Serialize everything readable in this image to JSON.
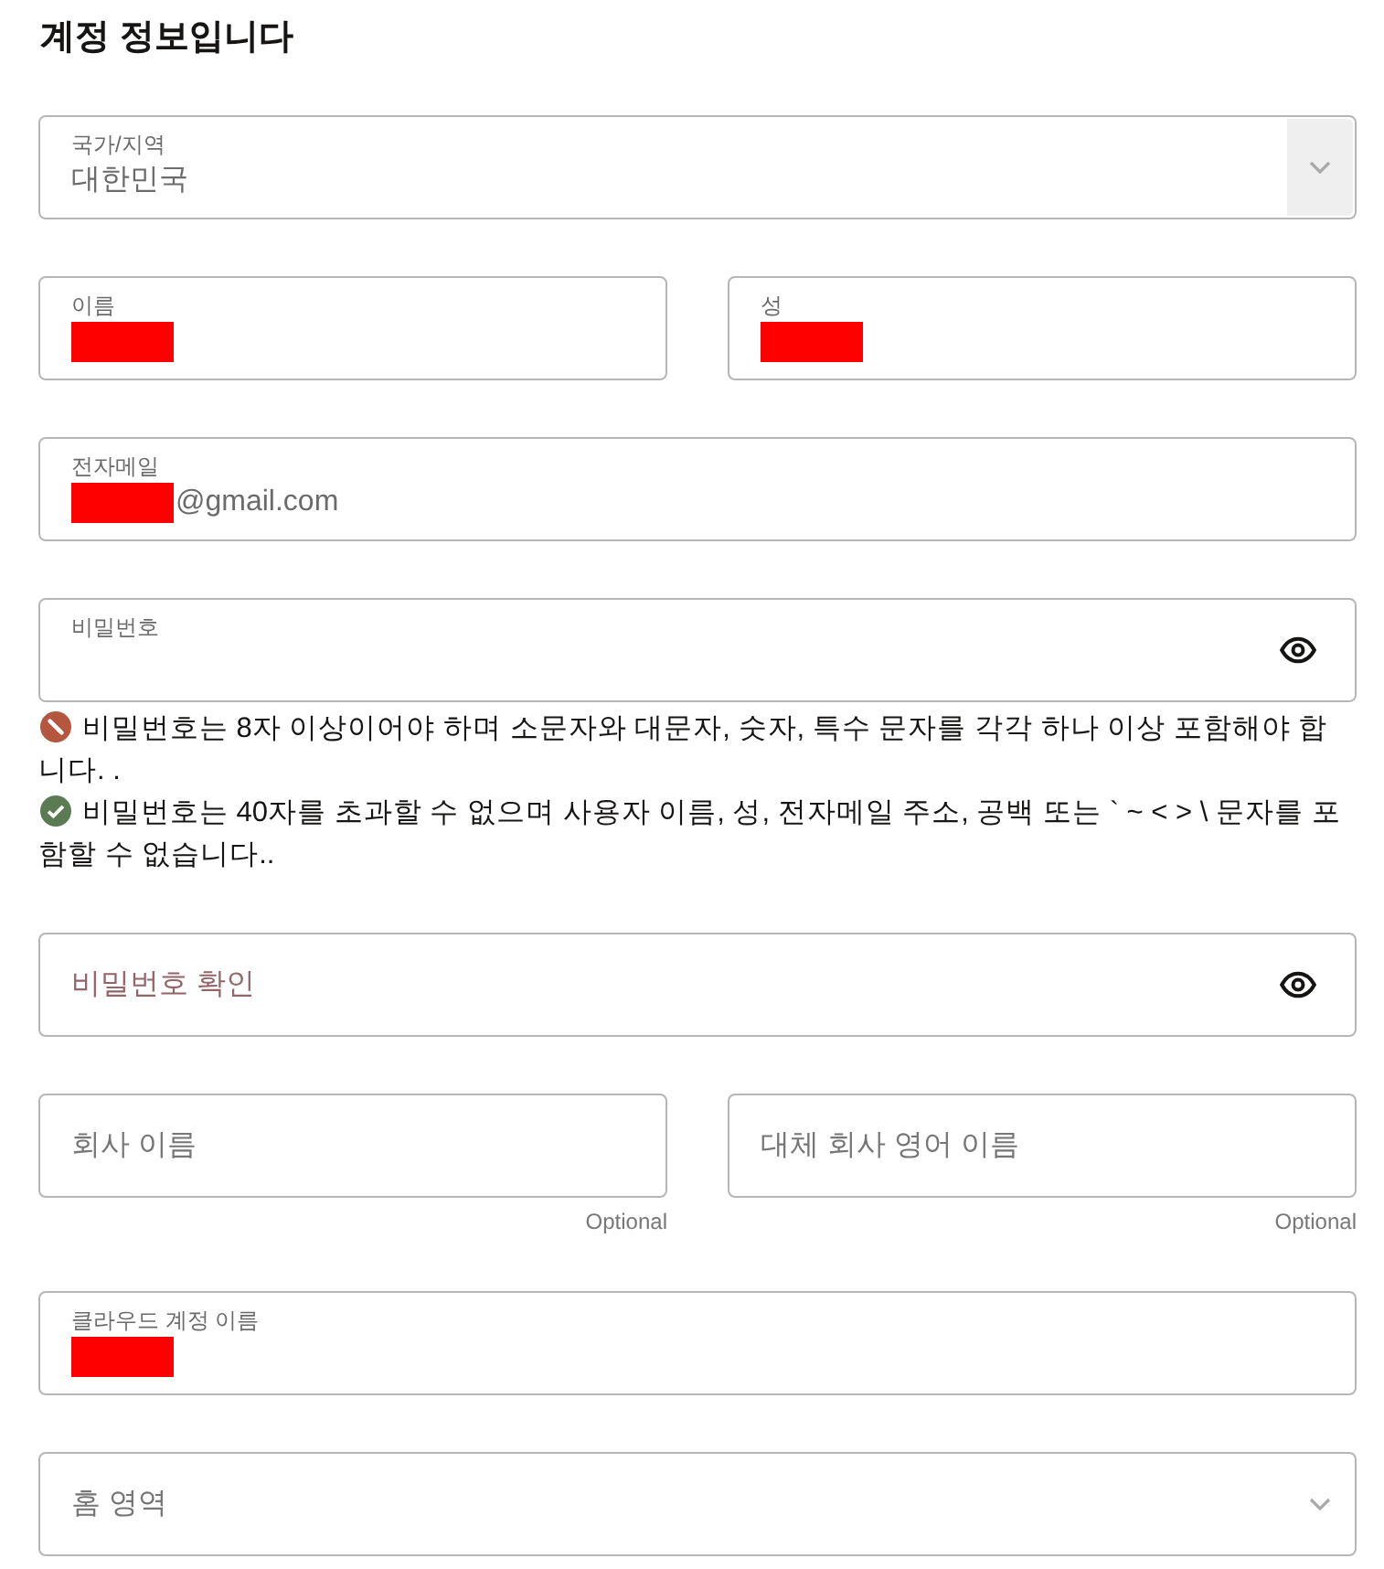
{
  "heading": "계정 정보입니다",
  "rows": [
    [
      {
        "kind": "select",
        "label": "국가/지역",
        "value": "대한민국",
        "toggle_shaded": true
      }
    ],
    [
      {
        "kind": "text",
        "label": "이름",
        "redacted": true
      },
      {
        "kind": "text",
        "label": "성",
        "redacted": true
      }
    ],
    [
      {
        "kind": "text",
        "label": "전자메일",
        "redacted": true,
        "value": "@gmail.com"
      }
    ],
    [
      {
        "kind": "password",
        "label": "비밀번호",
        "rules": [
          {
            "met": false,
            "text": "비밀번호는 8자 이상이어야 하며 소문자와 대문자, 숫자, 특수 문자를 각각 하나 이상 포함해야 합니다. ."
          },
          {
            "met": true,
            "text": "비밀번호는 40자를 초과할 수 없으며 사용자 이름, 성, 전자메일 주소, 공백 또는 ` ~ < > \\ 문자를 포함할 수 없습니다.."
          }
        ]
      }
    ],
    [
      {
        "kind": "password",
        "placeholder": "비밀번호 확인"
      }
    ],
    [
      {
        "kind": "text",
        "placeholder": "회사 이름",
        "note": "Optional"
      },
      {
        "kind": "text",
        "placeholder": "대체 회사 영어 이름",
        "note": "Optional"
      }
    ],
    [
      {
        "kind": "text",
        "label": "클라우드 계정 이름",
        "redacted": true
      }
    ],
    [
      {
        "kind": "select",
        "placeholder": "홈 영역",
        "toggle_shaded": false
      }
    ]
  ]
}
